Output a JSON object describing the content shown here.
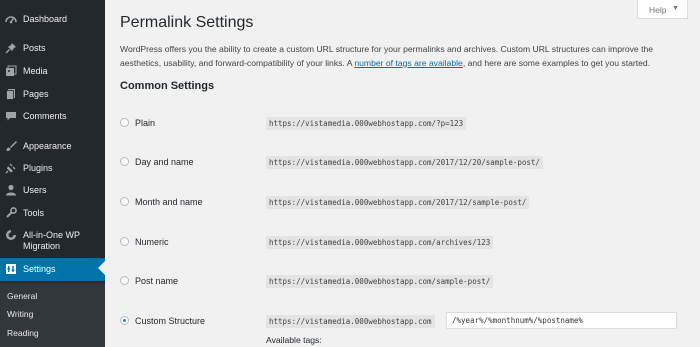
{
  "sidebar": {
    "items": [
      {
        "label": "Dashboard",
        "icon": "dashboard-icon"
      },
      {
        "label": "Posts",
        "icon": "pushpin-icon"
      },
      {
        "label": "Media",
        "icon": "media-icon"
      },
      {
        "label": "Pages",
        "icon": "page-icon"
      },
      {
        "label": "Comments",
        "icon": "comment-icon"
      },
      {
        "label": "Appearance",
        "icon": "paintbrush-icon"
      },
      {
        "label": "Plugins",
        "icon": "plugin-icon"
      },
      {
        "label": "Users",
        "icon": "user-icon"
      },
      {
        "label": "Tools",
        "icon": "wrench-icon"
      },
      {
        "label": "All-in-One WP Migration",
        "icon": "migration-icon"
      },
      {
        "label": "Settings",
        "icon": "settings-icon"
      }
    ],
    "submenu": [
      "General",
      "Writing",
      "Reading"
    ]
  },
  "help": {
    "label": "Help",
    "arrow": "▼"
  },
  "page": {
    "title": "Permalink Settings",
    "intro_before": "WordPress offers you the ability to create a custom URL structure for your permalinks and archives. Custom URL structures can improve the aesthetics, usability, and forward-compatibility of your links. A ",
    "intro_link": "number of tags are available",
    "intro_after": ", and here are some examples to get you started.",
    "common_heading": "Common Settings"
  },
  "options": [
    {
      "label": "Plain",
      "example": "https://vistamedia.000webhostapp.com/?p=123",
      "selected": false
    },
    {
      "label": "Day and name",
      "example": "https://vistamedia.000webhostapp.com/2017/12/20/sample-post/",
      "selected": false
    },
    {
      "label": "Month and name",
      "example": "https://vistamedia.000webhostapp.com/2017/12/sample-post/",
      "selected": false
    },
    {
      "label": "Numeric",
      "example": "https://vistamedia.000webhostapp.com/archives/123",
      "selected": false
    },
    {
      "label": "Post name",
      "example": "https://vistamedia.000webhostapp.com/sample-post/",
      "selected": false
    },
    {
      "label": "Custom Structure",
      "example": "https://vistamedia.000webhostapp.com",
      "selected": true
    }
  ],
  "custom_structure_value": "/%year%/%monthnum%/%postname%",
  "available_tags_label": "Available tags:",
  "colors": {
    "sidebar_bg": "#23282d",
    "accent": "#0073aa",
    "page_bg": "#f1f1f1"
  }
}
